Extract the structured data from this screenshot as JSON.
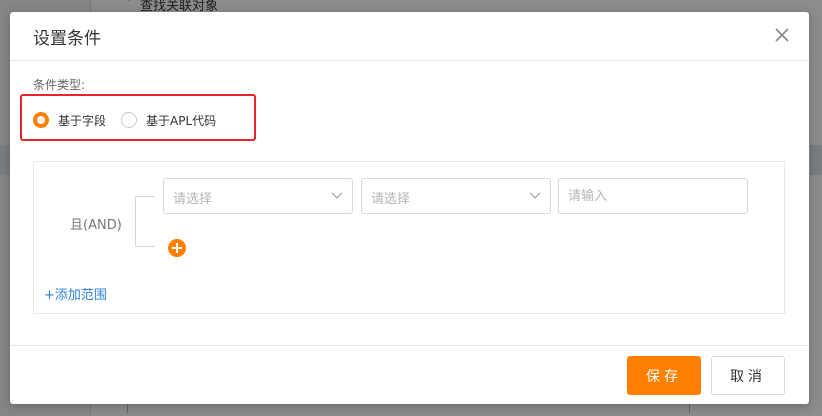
{
  "background": {
    "field_label": "查找关联对象"
  },
  "dialog": {
    "title": "设置条件",
    "condition_type_label": "条件类型:",
    "condition_types": [
      {
        "label": "基于字段",
        "checked": true
      },
      {
        "label": "基于APL代码",
        "checked": false
      }
    ],
    "range": {
      "logic_label": "且(AND)",
      "field_select_placeholder": "请选择",
      "operator_select_placeholder": "请选择",
      "value_input_placeholder": "请输入",
      "add_range_label": "+添加范围"
    },
    "footer": {
      "save_label": "保存",
      "cancel_label": "取消"
    }
  },
  "colors": {
    "accent": "#ff8000",
    "highlight": "#e6262b",
    "link": "#2f7fd6"
  },
  "icons": [
    "close-icon",
    "chevron-down-icon",
    "add-condition-icon"
  ]
}
